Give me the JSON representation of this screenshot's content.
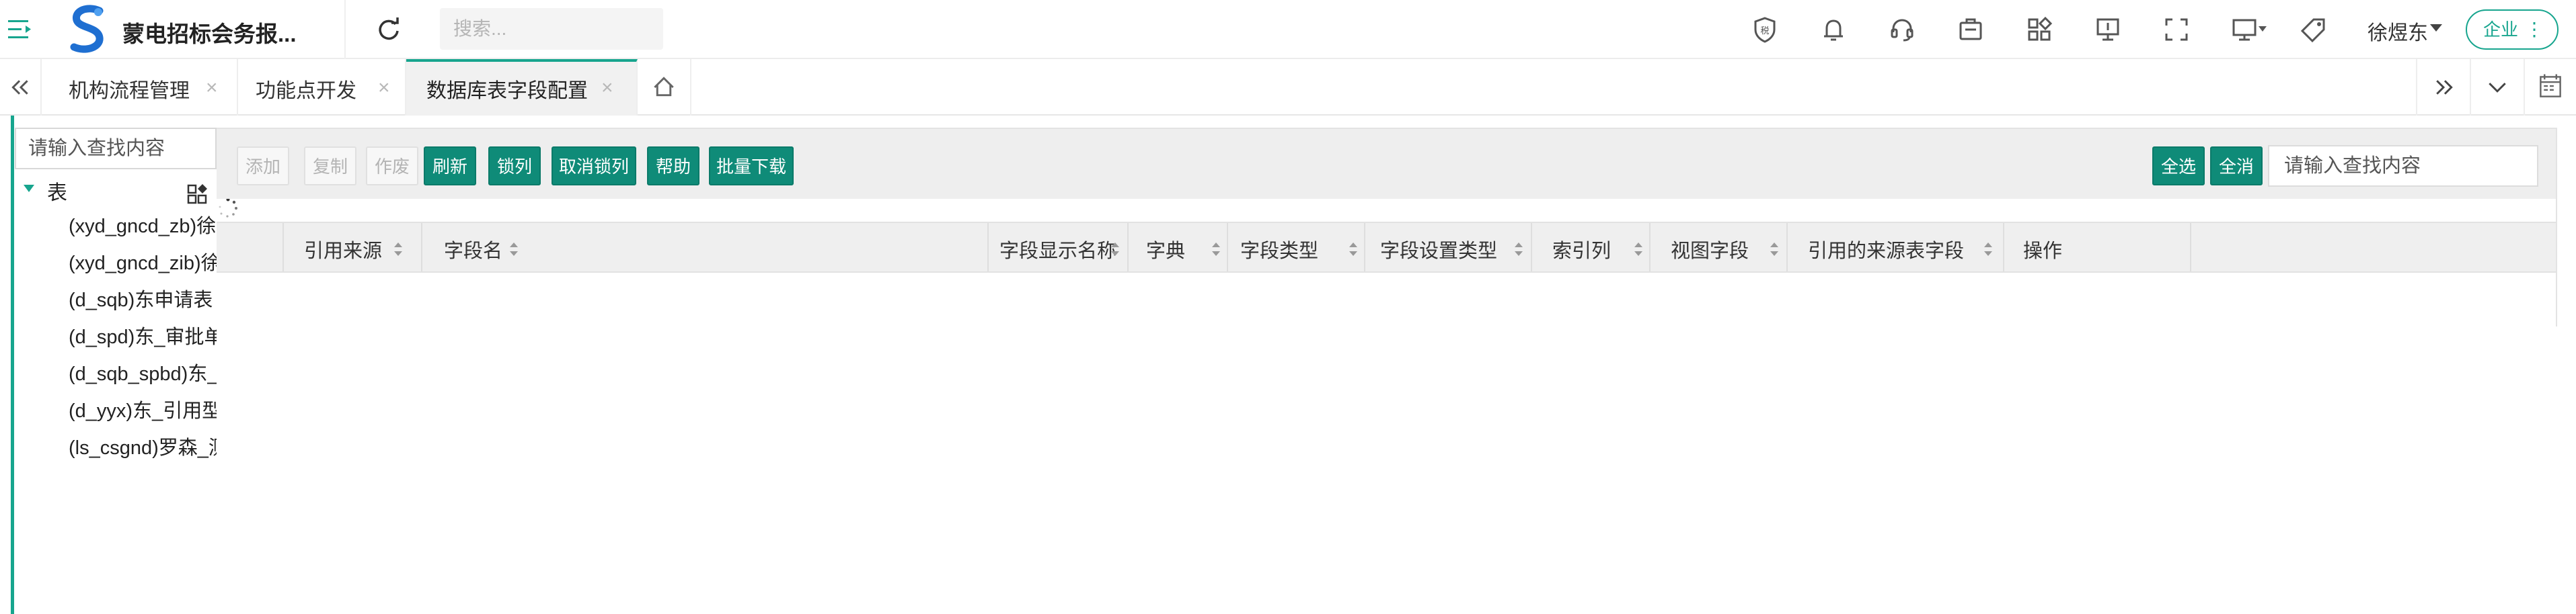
{
  "header": {
    "app_title": "蒙电招标会务报...",
    "search_placeholder": "搜索...",
    "user_name": "徐煜东",
    "company_label": "企业",
    "company_more": "⋮"
  },
  "tabs": [
    {
      "label": "机构流程管理",
      "close": "×",
      "active": false
    },
    {
      "label": "功能点开发",
      "close": "×",
      "active": false
    },
    {
      "label": "数据库表字段配置",
      "close": "×",
      "active": true
    }
  ],
  "tree": {
    "search_placeholder": "请输入查找内容",
    "root_label": "表",
    "items": [
      "(xyd_gncd_zb)徐煜东",
      "(xyd_gncd_zib)徐煜东",
      "(d_sqb)东申请表",
      "(d_spd)东_审批单",
      "(d_sqb_spbd)东_审批",
      "(d_yyx)东_引用型",
      "(ls_csgnd)罗森_测试"
    ]
  },
  "toolbar": {
    "add": "添加",
    "copy": "复制",
    "void": "作废",
    "refresh": "刷新",
    "lock_col": "锁列",
    "unlock_col": "取消锁列",
    "help": "帮助",
    "batch_download": "批量下载",
    "select_all": "全选",
    "deselect_all": "全消",
    "search_placeholder": "请输入查找内容"
  },
  "table": {
    "columns": [
      "引用来源",
      "字段名",
      "字段显示名称",
      "字典",
      "字段类型",
      "字段设置类型",
      "索引列",
      "视图字段",
      "引用的来源表字段",
      "操作"
    ]
  },
  "colors": {
    "accent": "#17a58e",
    "button": "#0f8b78"
  }
}
